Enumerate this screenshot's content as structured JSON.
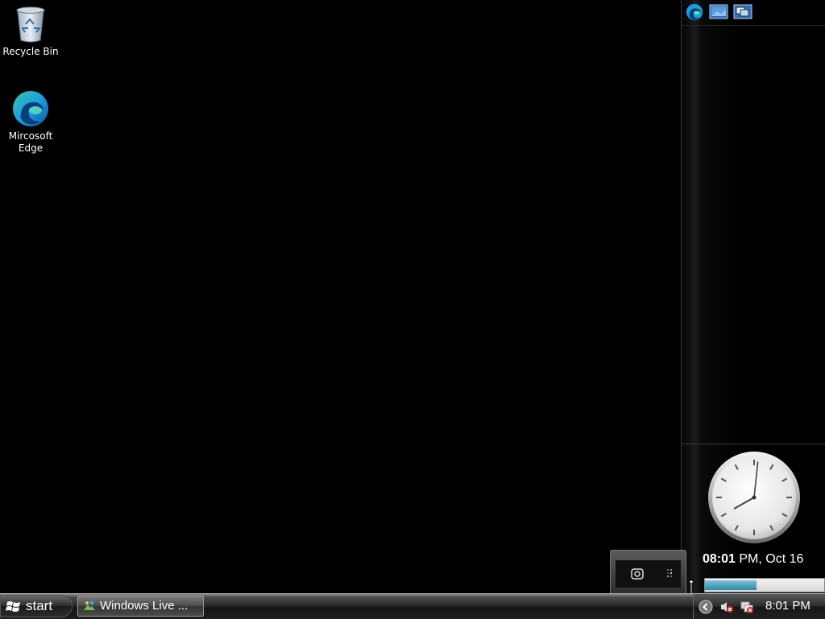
{
  "desktop": {
    "icons": [
      {
        "label": "Recycle Bin",
        "icon": "recycle-bin-icon"
      },
      {
        "label": "Mircosoft Edge",
        "icon": "edge-icon"
      }
    ]
  },
  "sidebar": {
    "toolbar": [
      "edge-icon",
      "desktop-icon",
      "switch-windows-icon"
    ],
    "clock": {
      "time_bold": "08:01",
      "rest": " PM, Oct 16",
      "hour": 8,
      "minute": 1
    },
    "meter_fill_fraction": 0.43
  },
  "taskbar": {
    "start_label": "start",
    "task_label": "Windows Live ...",
    "tray_icons": [
      "expand-tray-icon",
      "volume-muted-icon",
      "network-icon"
    ],
    "time": "8:01 PM"
  },
  "colors": {
    "accent": "#2a8aa8",
    "desktop_bg": "#000000"
  }
}
